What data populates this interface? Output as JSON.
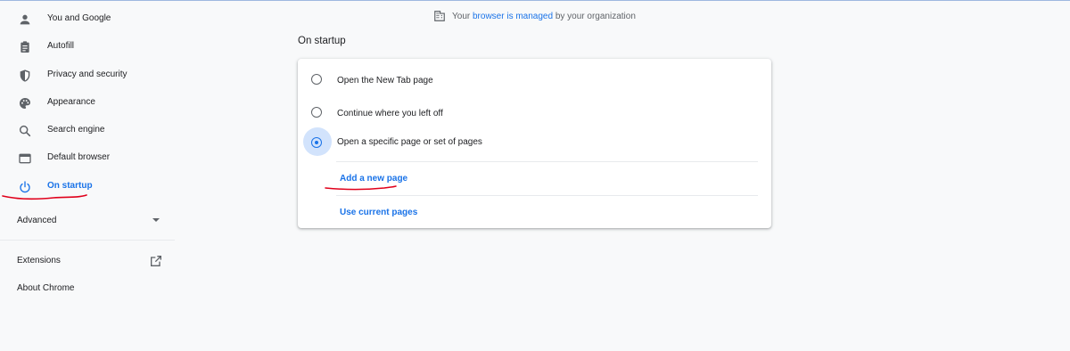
{
  "sidebar": {
    "items": [
      {
        "label": "You and Google",
        "icon": "person-icon"
      },
      {
        "label": "Autofill",
        "icon": "clipboard-icon"
      },
      {
        "label": "Privacy and security",
        "icon": "shield-icon"
      },
      {
        "label": "Appearance",
        "icon": "palette-icon"
      },
      {
        "label": "Search engine",
        "icon": "search-icon"
      },
      {
        "label": "Default browser",
        "icon": "browser-window-icon"
      },
      {
        "label": "On startup",
        "icon": "power-icon",
        "active": true
      }
    ],
    "advanced_label": "Advanced",
    "extensions_label": "Extensions",
    "about_label": "About Chrome"
  },
  "managed_banner": {
    "prefix": "Your",
    "link": "browser is managed",
    "suffix": "by your organization"
  },
  "section": {
    "title": "On startup",
    "options": [
      {
        "label": "Open the New Tab page",
        "checked": false
      },
      {
        "label": "Continue where you left off",
        "checked": false
      },
      {
        "label": "Open a specific page or set of pages",
        "checked": true
      }
    ],
    "add_page_label": "Add a new page",
    "use_current_label": "Use current pages"
  },
  "colors": {
    "accent": "#1a73e8",
    "annotation": "#e0001b",
    "background": "#f8f9fa"
  }
}
